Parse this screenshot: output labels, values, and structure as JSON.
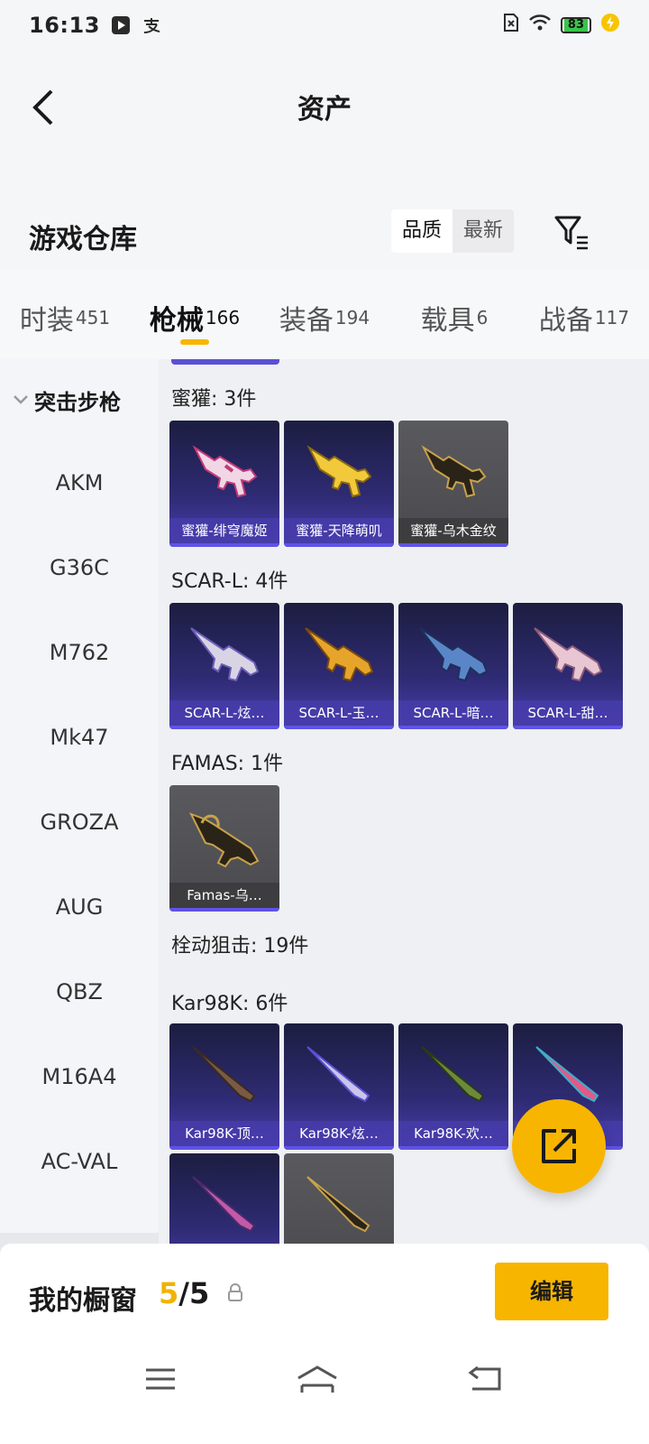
{
  "status_bar": {
    "time": "16:13",
    "icons": [
      "video-app-icon",
      "alipay-icon",
      "sim-icon",
      "wifi-icon",
      "battery-icon",
      "charging-icon"
    ],
    "battery": "83"
  },
  "header": {
    "title": "资产",
    "back_icon": "chevron-left-icon"
  },
  "warehouse": {
    "title": "游戏仓库",
    "sort_options": [
      "品质",
      "最新"
    ],
    "selected_sort": "品质",
    "filter_icon": "filter-icon"
  },
  "tabs": [
    {
      "label": "时装",
      "count": "451"
    },
    {
      "label": "枪械",
      "count": "166"
    },
    {
      "label": "装备",
      "count": "194"
    },
    {
      "label": "载具",
      "count": "6"
    },
    {
      "label": "战备",
      "count": "117"
    }
  ],
  "active_tab": "枪械",
  "sidebar": {
    "category": "突击步枪",
    "items": [
      "AKM",
      "G36C",
      "M762",
      "Mk47",
      "GROZA",
      "AUG",
      "QBZ",
      "M16A4",
      "AC-VAL"
    ]
  },
  "groups": [
    {
      "title": "蜜獾: 3件",
      "items": [
        "蜜獾-绯穹魔姬",
        "蜜獾-天降萌叽",
        "蜜獾-乌木金纹"
      ]
    },
    {
      "title": "SCAR-L: 4件",
      "items": [
        "SCAR-L-炫…",
        "SCAR-L-玉…",
        "SCAR-L-暗…",
        "SCAR-L-甜…"
      ]
    },
    {
      "title": "FAMAS: 1件",
      "items": [
        "Famas-乌…"
      ]
    },
    {
      "title": "栓动狙击: 19件",
      "items": []
    },
    {
      "title": "Kar98K: 6件",
      "items": [
        "Kar98K-顶…",
        "Kar98K-炫…",
        "Kar98K-欢…",
        "",
        "",
        ""
      ]
    }
  ],
  "colors": {
    "accent": "#f7b500",
    "rare_purple": "#4b3fb0",
    "common_gray": "#4a4a4e"
  },
  "showcase": {
    "label": "我的橱窗",
    "current": "5",
    "total": "/5",
    "lock_icon": "lock-icon",
    "edit_label": "编辑"
  },
  "share_icon": "share-icon",
  "navbar": {
    "icons": [
      "menu-icon",
      "home-icon",
      "back-icon"
    ]
  }
}
